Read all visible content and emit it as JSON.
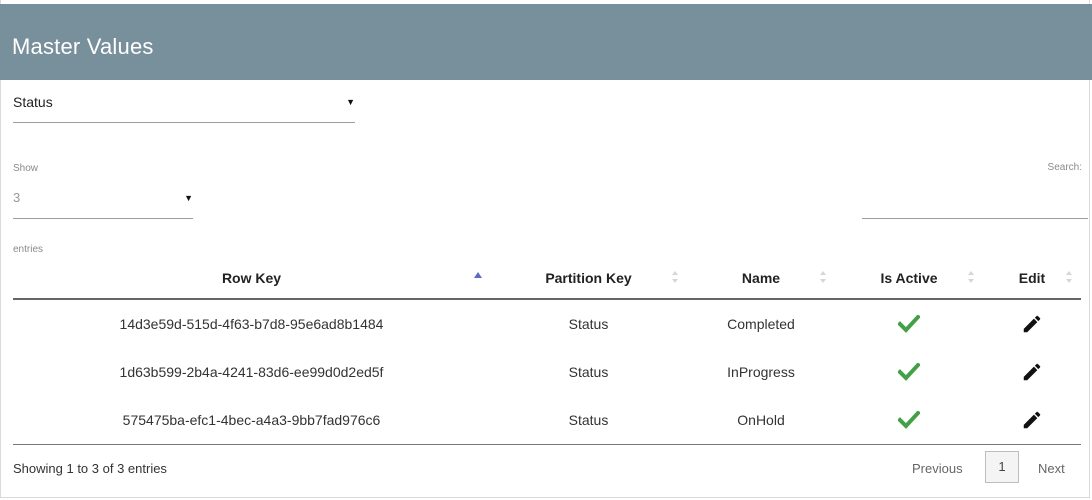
{
  "header": {
    "title": "Master Values"
  },
  "type_select": {
    "value": "Status"
  },
  "length_control": {
    "label_before": "Show",
    "value": "3",
    "label_after": "entries"
  },
  "search": {
    "label": "Search:",
    "value": ""
  },
  "table": {
    "columns": [
      "Row Key",
      "Partition Key",
      "Name",
      "Is Active",
      "Edit"
    ],
    "sorted_column": "Row Key",
    "sort_direction": "ascending",
    "rows": [
      {
        "row_key": "14d3e59d-515d-4f63-b7d8-95e6ad8b1484",
        "partition_key": "Status",
        "name": "Completed",
        "is_active_icon": "check-icon",
        "edit_icon": "pencil-icon"
      },
      {
        "row_key": "1d63b599-2b4a-4241-83d6-ee99d0d2ed5f",
        "partition_key": "Status",
        "name": "InProgress",
        "is_active_icon": "check-icon",
        "edit_icon": "pencil-icon"
      },
      {
        "row_key": "575475ba-efc1-4bec-a4a3-9bb7fad976c6",
        "partition_key": "Status",
        "name": "OnHold",
        "is_active_icon": "check-icon",
        "edit_icon": "pencil-icon"
      }
    ]
  },
  "footer": {
    "info": "Showing 1 to 3 of 3 entries",
    "previous_label": "Previous",
    "current_page": "1",
    "next_label": "Next"
  },
  "colors": {
    "header_bg": "#78909c",
    "check_green": "#43a047",
    "sort_active": "#5c6bc0",
    "sort_inactive": "#d6d6d6"
  }
}
